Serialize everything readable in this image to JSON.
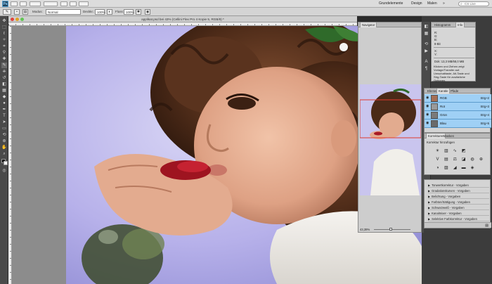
{
  "app": {
    "logo": "Ps",
    "workspaces": [
      "Grundelemente",
      "Design",
      "Malen"
    ],
    "search_placeholder": "CS Live"
  },
  "options": {
    "mode_label": "Modus:",
    "mode_value": "Normal",
    "opacity_label": "Deckkr.:",
    "opacity_value": "100%",
    "flow_label": "Fluss:",
    "flow_value": "100%"
  },
  "document": {
    "title": "applikat.psd bei 43% (Cellini Flex Pro 4 Kopie 5, RGB/8) *"
  },
  "navigator": {
    "tabs": [
      "Navigator"
    ],
    "zoom_value": "43,39%"
  },
  "info": {
    "tabs": [
      "Histogramm",
      "Info"
    ],
    "values": [
      "R:",
      "G:",
      "B:",
      "8-Bit",
      "X:",
      "Y:",
      "Dok: 13,3 MB/68,0 MB"
    ],
    "note": "Klicken und Ziehen zeigt Vorlage/Transfer auf. Umschalttaste, Alt-Taste und Strg-Taste für zusätzliche Optionen."
  },
  "channels": {
    "tabs": [
      "Ebenen",
      "Kanäle",
      "Pfade"
    ],
    "items": [
      {
        "name": "RGB",
        "key": "Strg+2"
      },
      {
        "name": "Rot",
        "key": "Strg+3"
      },
      {
        "name": "Grün",
        "key": "Strg+4"
      },
      {
        "name": "Blau",
        "key": "Strg+5"
      }
    ]
  },
  "adjustments": {
    "tabs": [
      "Korrekturen",
      "Masken"
    ],
    "heading": "Korrektur hinzufügen"
  },
  "presets": {
    "items": [
      {
        "name": "Tonwertkorrektur - Vorgaben"
      },
      {
        "name": "Gradationskurven - Vorgaben"
      },
      {
        "name": "Belichtung - Vorgaben"
      },
      {
        "name": "Farbton/Sättigung - Vorgaben"
      },
      {
        "name": "Schwarzweiß - Vorgaben"
      },
      {
        "name": "Kanalmixer - Vorgaben"
      },
      {
        "name": "Selektive Farbkorrektur - Vorgaben"
      }
    ]
  },
  "colors": {
    "selection": "#9fd0f5",
    "panel": "#d4d4d4",
    "canvas_bg": "#8c8c8c"
  }
}
